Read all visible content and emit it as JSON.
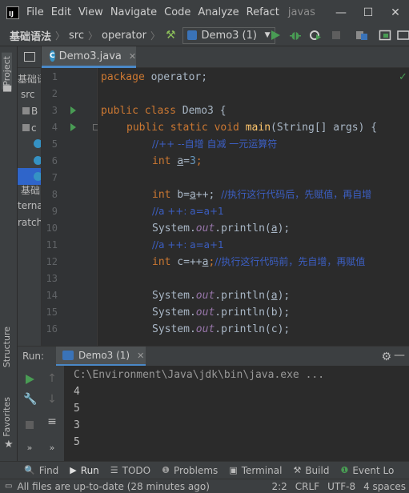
{
  "menubar": {
    "logo_text": "IJ",
    "items": [
      "File",
      "Edit",
      "View",
      "Navigate",
      "Code",
      "Analyze",
      "Refact"
    ],
    "title": "javas"
  },
  "navbar": {
    "crumbs": [
      "基础语法",
      "src",
      "operator"
    ],
    "run_config": "Demo3 (1)"
  },
  "left_stripe": {
    "project": "Project",
    "structure": "Structure",
    "favorites": "Favorites"
  },
  "project_tree": [
    "基础语法",
    "src",
    "B",
    "c",
    "",
    "",
    "",
    "基础",
    "terna",
    "ratch"
  ],
  "editor": {
    "tab_label": "Demo3.java",
    "lines": [
      {
        "n": "1"
      },
      {
        "n": "2"
      },
      {
        "n": "3"
      },
      {
        "n": "4"
      },
      {
        "n": "5"
      },
      {
        "n": "6"
      },
      {
        "n": "7"
      },
      {
        "n": "8"
      },
      {
        "n": "9"
      },
      {
        "n": "10"
      },
      {
        "n": "11"
      },
      {
        "n": "12"
      },
      {
        "n": "13"
      },
      {
        "n": "14"
      },
      {
        "n": "15"
      },
      {
        "n": "16"
      }
    ],
    "code": {
      "l1_kw": "package",
      "l1_rest": " operator;",
      "l3_kw": "public class",
      "l3_rest": " Demo3 {",
      "l4_kw": "public static void",
      "l4_fn": "main",
      "l4_rest": "(String[] args) {",
      "l5_cm": "//++ --自增 自减 一元运算符",
      "l6_kw": "int",
      "l6_var": "a",
      "l6_eq": "=",
      "l6_num": "3",
      "l6_end": ";",
      "l8_kw": "int",
      "l8_pre": " b=",
      "l8_var": "a",
      "l8_post": "++; ",
      "l8_cm": "//执行这行代码后，先赋值，再自增",
      "l9_cm": "//a ++: a=a+1",
      "l10_pre": "System.",
      "l10_fld": "out",
      "l10_mid": ".println(",
      "l10_var": "a",
      "l10_end": ");",
      "l11_cm": "//a ++: a=a+1",
      "l12_kw": "int",
      "l12_pre": " c=++",
      "l12_var": "a",
      "l12_end": ";",
      "l12_cm": "//执行这行代码前，先自增，再赋值",
      "l14_pre": "System.",
      "l14_fld": "out",
      "l14_mid": ".println(",
      "l14_var": "a",
      "l14_end": ");",
      "l15_pre": "System.",
      "l15_fld": "out",
      "l15_mid": ".println(",
      "l15_var": "b",
      "l15_end": ");",
      "l16_pre": "System.",
      "l16_fld": "out",
      "l16_mid": ".println(",
      "l16_var": "c",
      "l16_end": ");"
    }
  },
  "run_panel": {
    "label": "Run:",
    "tab_label": "Demo3 (1)",
    "console": [
      "C:\\Environment\\Java\\jdk\\bin\\java.exe ...",
      "4",
      "5",
      "3",
      "5"
    ]
  },
  "bottom_tabs": [
    {
      "icon": "🔍",
      "label": "Find"
    },
    {
      "icon": "▶",
      "label": "Run"
    },
    {
      "icon": "☰",
      "label": "TODO"
    },
    {
      "icon": "❶",
      "label": "Problems"
    },
    {
      "icon": "▣",
      "label": "Terminal"
    },
    {
      "icon": "⚒",
      "label": "Build"
    },
    {
      "icon": "❶",
      "label": "Event Lo"
    }
  ],
  "status": {
    "message": "All files are up-to-date (28 minutes ago)",
    "position": "2:2",
    "line_sep": "CRLF",
    "encoding": "UTF-8",
    "indent": "4 spaces"
  },
  "colors": {
    "keyword": "#cc7832",
    "comment": "#3c5fc4",
    "run_green": "#499c54",
    "accent_blue": "#4a88c7"
  }
}
